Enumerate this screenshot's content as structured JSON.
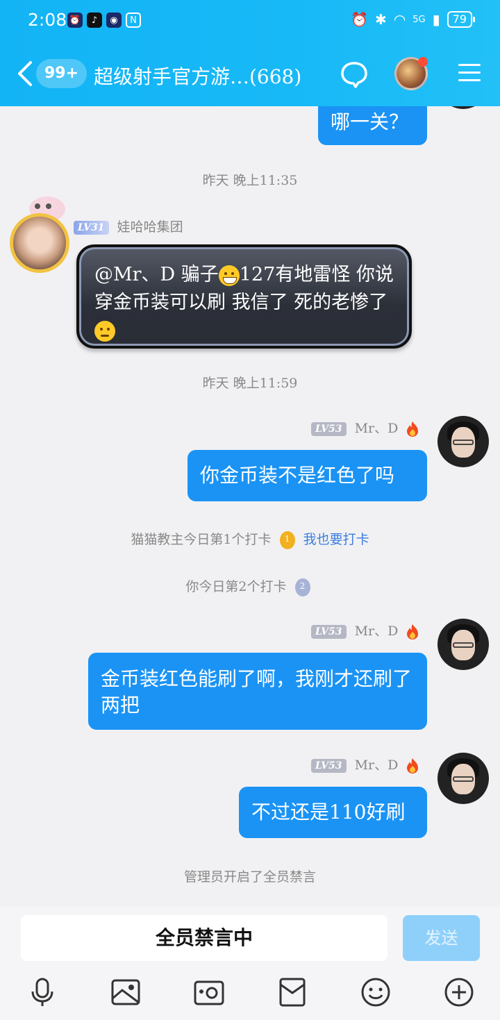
{
  "status": {
    "time": "2:08",
    "network": "5G",
    "battery": "79"
  },
  "nav": {
    "unread": "99+",
    "title": "超级射手官方游…(668)"
  },
  "messages": {
    "m1": "哪一关？",
    "ts1": "昨天 晚上11:35",
    "other_level": "LV31",
    "other_name": "娃哈哈集团",
    "m2_a": "@Mr、D 骗子",
    "m2_b": "127有地雷怪 你说穿金币装可以刷 我信了 死的老惨了",
    "ts2": "昨天 晚上11:59",
    "me_level": "LV53",
    "me_name": "Mr、D",
    "m3": "你金币装不是红色了吗",
    "checkin1_text": "猫猫教主今日第1个打卡",
    "checkin1_rank": "1",
    "checkin_link": "我也要打卡",
    "checkin2_text": "你今日第2个打卡",
    "checkin2_rank": "2",
    "m4": "金币装红色能刷了啊，我刚才还刷了两把",
    "m5": "不过还是110好刷",
    "sys_mute": "管理员开启了全员禁言"
  },
  "input": {
    "placeholder": "全员禁言中",
    "send": "发送"
  },
  "icons": {
    "toolbar": [
      "microphone-icon",
      "image-icon",
      "camera-icon",
      "red-packet-icon",
      "emoji-icon",
      "plus-icon"
    ]
  }
}
